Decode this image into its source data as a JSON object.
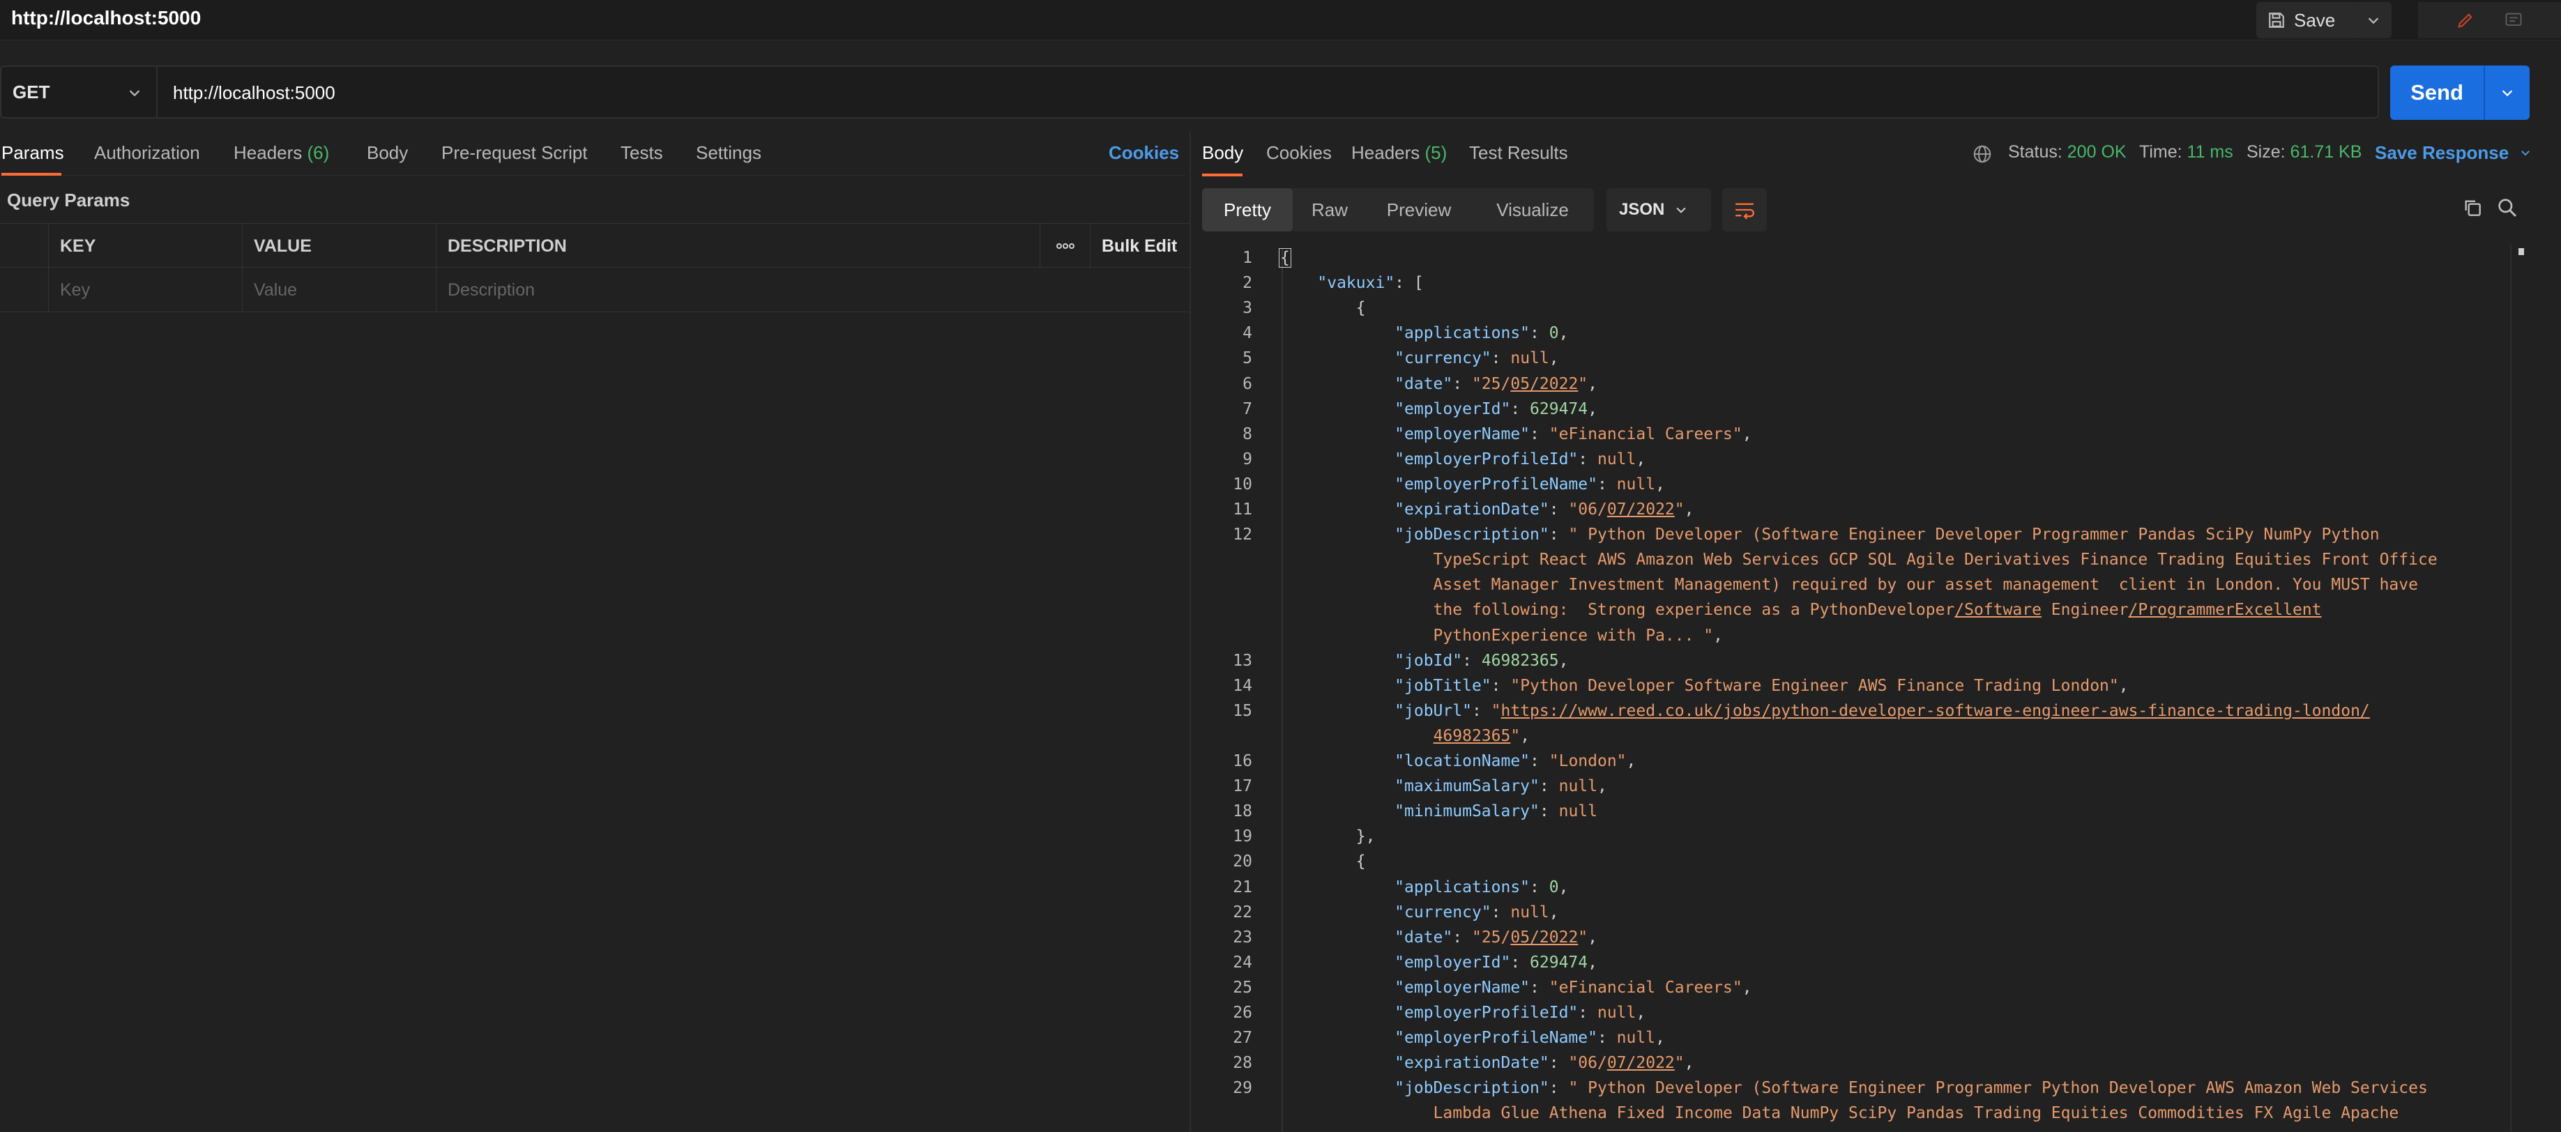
{
  "window": {
    "title": "http://localhost:5000"
  },
  "titlebar": {
    "save_label": "Save"
  },
  "request": {
    "method": "GET",
    "url": "http://localhost:5000",
    "send_label": "Send",
    "tabs": [
      {
        "label": "Params",
        "count": ""
      },
      {
        "label": "Authorization",
        "count": ""
      },
      {
        "label": "Headers",
        "count": "(6)"
      },
      {
        "label": "Body",
        "count": ""
      },
      {
        "label": "Pre-request Script",
        "count": ""
      },
      {
        "label": "Tests",
        "count": ""
      },
      {
        "label": "Settings",
        "count": ""
      }
    ],
    "cookies_label": "Cookies",
    "query_params": {
      "title": "Query Params",
      "columns": [
        "KEY",
        "VALUE",
        "DESCRIPTION"
      ],
      "bulk_edit_label": "Bulk Edit",
      "placeholders": [
        "Key",
        "Value",
        "Description"
      ]
    }
  },
  "response": {
    "tabs": [
      {
        "label": "Body",
        "count": ""
      },
      {
        "label": "Cookies",
        "count": ""
      },
      {
        "label": "Headers",
        "count": "(5)"
      },
      {
        "label": "Test Results",
        "count": ""
      }
    ],
    "status_label": "Status:",
    "status_value": "200 OK",
    "time_label": "Time:",
    "time_value": "11 ms",
    "size_label": "Size:",
    "size_value": "61.71 KB",
    "save_response_label": "Save Response",
    "modes": [
      "Pretty",
      "Raw",
      "Preview",
      "Visualize"
    ],
    "format": "JSON",
    "lines": [
      {
        "num": "1",
        "segs": [
          {
            "t": "{",
            "c": "p"
          }
        ]
      },
      {
        "num": "2",
        "segs": [
          {
            "t": "    "
          },
          {
            "t": "\"vakuxi\"",
            "c": "k"
          },
          {
            "t": ": ["
          }
        ]
      },
      {
        "num": "3",
        "segs": [
          {
            "t": "        {"
          }
        ]
      },
      {
        "num": "4",
        "segs": [
          {
            "t": "            "
          },
          {
            "t": "\"applications\"",
            "c": "k"
          },
          {
            "t": ": "
          },
          {
            "t": "0",
            "c": "n"
          },
          {
            "t": ","
          }
        ]
      },
      {
        "num": "5",
        "segs": [
          {
            "t": "            "
          },
          {
            "t": "\"currency\"",
            "c": "k"
          },
          {
            "t": ": "
          },
          {
            "t": "null",
            "c": "nl"
          },
          {
            "t": ","
          }
        ]
      },
      {
        "num": "6",
        "segs": [
          {
            "t": "            "
          },
          {
            "t": "\"date\"",
            "c": "k"
          },
          {
            "t": ": "
          },
          {
            "t": "\"25/",
            "c": "s"
          },
          {
            "t": "05/2022",
            "c": "s u"
          },
          {
            "t": "\"",
            "c": "s"
          },
          {
            "t": ","
          }
        ]
      },
      {
        "num": "7",
        "segs": [
          {
            "t": "            "
          },
          {
            "t": "\"employerId\"",
            "c": "k"
          },
          {
            "t": ": "
          },
          {
            "t": "629474",
            "c": "n"
          },
          {
            "t": ","
          }
        ]
      },
      {
        "num": "8",
        "segs": [
          {
            "t": "            "
          },
          {
            "t": "\"employerName\"",
            "c": "k"
          },
          {
            "t": ": "
          },
          {
            "t": "\"eFinancial Careers\"",
            "c": "s"
          },
          {
            "t": ","
          }
        ]
      },
      {
        "num": "9",
        "segs": [
          {
            "t": "            "
          },
          {
            "t": "\"employerProfileId\"",
            "c": "k"
          },
          {
            "t": ": "
          },
          {
            "t": "null",
            "c": "nl"
          },
          {
            "t": ","
          }
        ]
      },
      {
        "num": "10",
        "segs": [
          {
            "t": "            "
          },
          {
            "t": "\"employerProfileName\"",
            "c": "k"
          },
          {
            "t": ": "
          },
          {
            "t": "null",
            "c": "nl"
          },
          {
            "t": ","
          }
        ]
      },
      {
        "num": "11",
        "segs": [
          {
            "t": "            "
          },
          {
            "t": "\"expirationDate\"",
            "c": "k"
          },
          {
            "t": ": "
          },
          {
            "t": "\"06/",
            "c": "s"
          },
          {
            "t": "07/2022",
            "c": "s u"
          },
          {
            "t": "\"",
            "c": "s"
          },
          {
            "t": ","
          }
        ]
      },
      {
        "num": "12",
        "segs": [
          {
            "t": "            "
          },
          {
            "t": "\"jobDescription\"",
            "c": "k"
          },
          {
            "t": ": "
          },
          {
            "t": "\" Python Developer (Software Engineer Developer Programmer Pandas SciPy NumPy Python",
            "c": "s"
          }
        ]
      },
      {
        "num": "",
        "segs": [
          {
            "t": "                TypeScript React AWS Amazon Web Services GCP SQL Agile Derivatives Finance Trading Equities Front Office",
            "c": "s"
          }
        ]
      },
      {
        "num": "",
        "segs": [
          {
            "t": "                Asset Manager Investment Management) required by our asset management  client in London. You MUST have",
            "c": "s"
          }
        ]
      },
      {
        "num": "",
        "segs": [
          {
            "t": "                the following:  Strong experience as a PythonDeveloper",
            "c": "s"
          },
          {
            "t": "/Software",
            "c": "s u"
          },
          {
            "t": " Engineer",
            "c": "s"
          },
          {
            "t": "/ProgrammerExcellent",
            "c": "s u"
          }
        ]
      },
      {
        "num": "",
        "segs": [
          {
            "t": "                PythonExperience with Pa... \"",
            "c": "s"
          },
          {
            "t": ","
          }
        ]
      },
      {
        "num": "13",
        "segs": [
          {
            "t": "            "
          },
          {
            "t": "\"jobId\"",
            "c": "k"
          },
          {
            "t": ": "
          },
          {
            "t": "46982365",
            "c": "n"
          },
          {
            "t": ","
          }
        ]
      },
      {
        "num": "14",
        "segs": [
          {
            "t": "            "
          },
          {
            "t": "\"jobTitle\"",
            "c": "k"
          },
          {
            "t": ": "
          },
          {
            "t": "\"Python Developer Software Engineer AWS Finance Trading London\"",
            "c": "s"
          },
          {
            "t": ","
          }
        ]
      },
      {
        "num": "15",
        "segs": [
          {
            "t": "            "
          },
          {
            "t": "\"jobUrl\"",
            "c": "k"
          },
          {
            "t": ": "
          },
          {
            "t": "\"",
            "c": "s"
          },
          {
            "t": "https://www.reed.co.uk/jobs/python-developer-software-engineer-aws-finance-trading-london/",
            "c": "s u"
          }
        ]
      },
      {
        "num": "",
        "segs": [
          {
            "t": "                "
          },
          {
            "t": "46982365",
            "c": "s u"
          },
          {
            "t": "\"",
            "c": "s"
          },
          {
            "t": ","
          }
        ]
      },
      {
        "num": "16",
        "segs": [
          {
            "t": "            "
          },
          {
            "t": "\"locationName\"",
            "c": "k"
          },
          {
            "t": ": "
          },
          {
            "t": "\"London\"",
            "c": "s"
          },
          {
            "t": ","
          }
        ]
      },
      {
        "num": "17",
        "segs": [
          {
            "t": "            "
          },
          {
            "t": "\"maximumSalary\"",
            "c": "k"
          },
          {
            "t": ": "
          },
          {
            "t": "null",
            "c": "nl"
          },
          {
            "t": ","
          }
        ]
      },
      {
        "num": "18",
        "segs": [
          {
            "t": "            "
          },
          {
            "t": "\"minimumSalary\"",
            "c": "k"
          },
          {
            "t": ": "
          },
          {
            "t": "null",
            "c": "nl"
          }
        ]
      },
      {
        "num": "19",
        "segs": [
          {
            "t": "        },"
          }
        ]
      },
      {
        "num": "20",
        "segs": [
          {
            "t": "        {"
          }
        ]
      },
      {
        "num": "21",
        "segs": [
          {
            "t": "            "
          },
          {
            "t": "\"applications\"",
            "c": "k"
          },
          {
            "t": ": "
          },
          {
            "t": "0",
            "c": "n"
          },
          {
            "t": ","
          }
        ]
      },
      {
        "num": "22",
        "segs": [
          {
            "t": "            "
          },
          {
            "t": "\"currency\"",
            "c": "k"
          },
          {
            "t": ": "
          },
          {
            "t": "null",
            "c": "nl"
          },
          {
            "t": ","
          }
        ]
      },
      {
        "num": "23",
        "segs": [
          {
            "t": "            "
          },
          {
            "t": "\"date\"",
            "c": "k"
          },
          {
            "t": ": "
          },
          {
            "t": "\"25/",
            "c": "s"
          },
          {
            "t": "05/2022",
            "c": "s u"
          },
          {
            "t": "\"",
            "c": "s"
          },
          {
            "t": ","
          }
        ]
      },
      {
        "num": "24",
        "segs": [
          {
            "t": "            "
          },
          {
            "t": "\"employerId\"",
            "c": "k"
          },
          {
            "t": ": "
          },
          {
            "t": "629474",
            "c": "n"
          },
          {
            "t": ","
          }
        ]
      },
      {
        "num": "25",
        "segs": [
          {
            "t": "            "
          },
          {
            "t": "\"employerName\"",
            "c": "k"
          },
          {
            "t": ": "
          },
          {
            "t": "\"eFinancial Careers\"",
            "c": "s"
          },
          {
            "t": ","
          }
        ]
      },
      {
        "num": "26",
        "segs": [
          {
            "t": "            "
          },
          {
            "t": "\"employerProfileId\"",
            "c": "k"
          },
          {
            "t": ": "
          },
          {
            "t": "null",
            "c": "nl"
          },
          {
            "t": ","
          }
        ]
      },
      {
        "num": "27",
        "segs": [
          {
            "t": "            "
          },
          {
            "t": "\"employerProfileName\"",
            "c": "k"
          },
          {
            "t": ": "
          },
          {
            "t": "null",
            "c": "nl"
          },
          {
            "t": ","
          }
        ]
      },
      {
        "num": "28",
        "segs": [
          {
            "t": "            "
          },
          {
            "t": "\"expirationDate\"",
            "c": "k"
          },
          {
            "t": ": "
          },
          {
            "t": "\"06/",
            "c": "s"
          },
          {
            "t": "07/2022",
            "c": "s u"
          },
          {
            "t": "\"",
            "c": "s"
          },
          {
            "t": ","
          }
        ]
      },
      {
        "num": "29",
        "segs": [
          {
            "t": "            "
          },
          {
            "t": "\"jobDescription\"",
            "c": "k"
          },
          {
            "t": ": "
          },
          {
            "t": "\" Python Developer (Software Engineer Programmer Python Developer AWS Amazon Web Services",
            "c": "s"
          }
        ]
      },
      {
        "num": "",
        "segs": [
          {
            "t": "                Lambda Glue Athena Fixed Income Data NumPy SciPy Pandas Trading Equities Commodities FX Agile Apache",
            "c": "s"
          }
        ]
      }
    ]
  },
  "colors": {
    "accent": "#ff6c37",
    "send": "#1a6ee0",
    "link": "#4c9be8",
    "success": "#48b86a",
    "json_key": "#8ecbff",
    "json_string": "#e59a6c",
    "json_number": "#9fd6a1"
  },
  "icons": {
    "save": "floppy-disk-icon",
    "edit": "pencil-icon",
    "comment": "comment-icon",
    "globe": "globe-icon",
    "copy": "copy-icon",
    "search": "search-icon",
    "wrap": "wrap-lines-icon",
    "more": "ellipsis-icon"
  }
}
